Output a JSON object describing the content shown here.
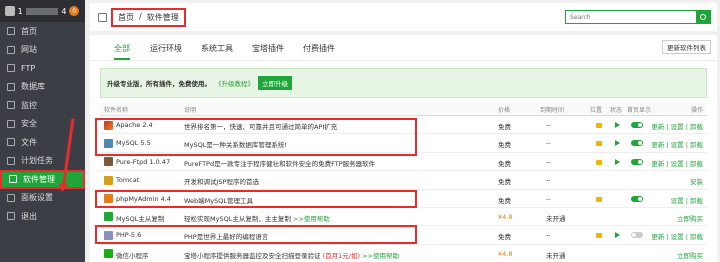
{
  "sidebar": {
    "title": "1",
    "title_suffix": "4",
    "badge": "0",
    "items": [
      {
        "label": "首页",
        "icon": "home-icon"
      },
      {
        "label": "网站",
        "icon": "globe-icon"
      },
      {
        "label": "FTP",
        "icon": "ftp-icon"
      },
      {
        "label": "数据库",
        "icon": "database-icon"
      },
      {
        "label": "监控",
        "icon": "monitor-icon"
      },
      {
        "label": "安全",
        "icon": "shield-icon"
      },
      {
        "label": "文件",
        "icon": "folder-icon"
      },
      {
        "label": "计划任务",
        "icon": "clock-icon"
      },
      {
        "label": "软件管理",
        "icon": "grid-icon",
        "active": true
      },
      {
        "label": "面板设置",
        "icon": "gear-icon"
      },
      {
        "label": "退出",
        "icon": "logout-icon"
      }
    ]
  },
  "breadcrumb": {
    "home": "首页",
    "sep": "/",
    "current": "软件管理"
  },
  "search": {
    "placeholder": "Search"
  },
  "tabs": [
    "全部",
    "运行环境",
    "系统工具",
    "宝塔插件",
    "付费插件"
  ],
  "update_button": "更新软件列表",
  "upgrade": {
    "prefix": "升级专业版，所有插件，免费使用。",
    "link": "《升级教程》",
    "button": "立即升级"
  },
  "table": {
    "headers": [
      "软件名称",
      "说明",
      "价格",
      "到期时间",
      "位置",
      "状态",
      "首页显示",
      "操作"
    ],
    "rows": [
      {
        "name": "Apache 2.4",
        "desc": "世界排名第一，快速、可靠并且可通过简单的API扩充",
        "price": "免费",
        "expire": "--",
        "ops": "更新 | 设置 | 卸载"
      },
      {
        "name": "MySQL 5.5",
        "desc": "MySQL是一种关系数据库管理系统!",
        "price": "免费",
        "expire": "--",
        "ops": "更新 | 设置 | 卸载"
      },
      {
        "name": "Pure-Ftpd 1.0.47",
        "desc": "PureFTPd是一款专注于程序健壮和软件安全的免费FTP服务器软件",
        "price": "免费",
        "expire": "--",
        "ops": "更新 | 设置 | 卸载"
      },
      {
        "name": "Tomcat",
        "desc": "开发和调试JSP程序的首选",
        "price": "免费",
        "expire": "--",
        "ops": "安装"
      },
      {
        "name": "phpMyAdmin 4.4",
        "desc": "Web端MySQL管理工具",
        "price": "免费",
        "expire": "--",
        "ops": "设置 | 卸载"
      },
      {
        "name": "MySQL主从复制",
        "desc": "轻松实现MySQL主从复制，主主复制",
        "desc_link": ">>使用帮助",
        "price": "¥4.8",
        "expire": "未开通",
        "ops": "立即购买"
      },
      {
        "name": "PHP-5.6",
        "desc": "PHP是世界上最好的编程语言",
        "price": "免费",
        "expire": "--",
        "ops": "更新 | 设置 | 卸载"
      },
      {
        "name": "微信小程序",
        "desc": "宝塔小程序提供服务器监控及安全扫描登录验证",
        "desc_hot": "(首月1元/如)",
        "desc_link": ">>使用帮助",
        "price": "¥4.8",
        "expire": "未开通",
        "ops": "立即购买"
      }
    ]
  },
  "colors": {
    "accent": "#20a53a",
    "highlight": "#e52d2d",
    "sidebar_bg": "#3b3e44",
    "warning": "#e57c1e"
  }
}
